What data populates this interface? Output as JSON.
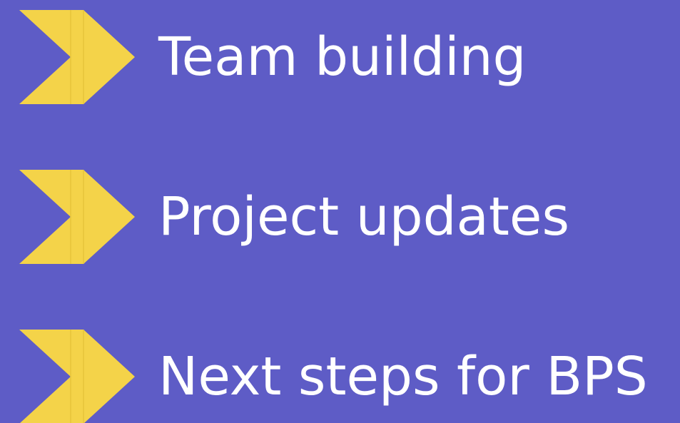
{
  "background_color": "#5e5cc6",
  "accent_color": "#f4d349",
  "agenda": {
    "items": [
      {
        "label": "Team building",
        "icon": "chevron-right-icon"
      },
      {
        "label": "Project updates",
        "icon": "chevron-right-icon"
      },
      {
        "label": "Next steps for BPS",
        "icon": "chevron-right-icon"
      }
    ]
  }
}
